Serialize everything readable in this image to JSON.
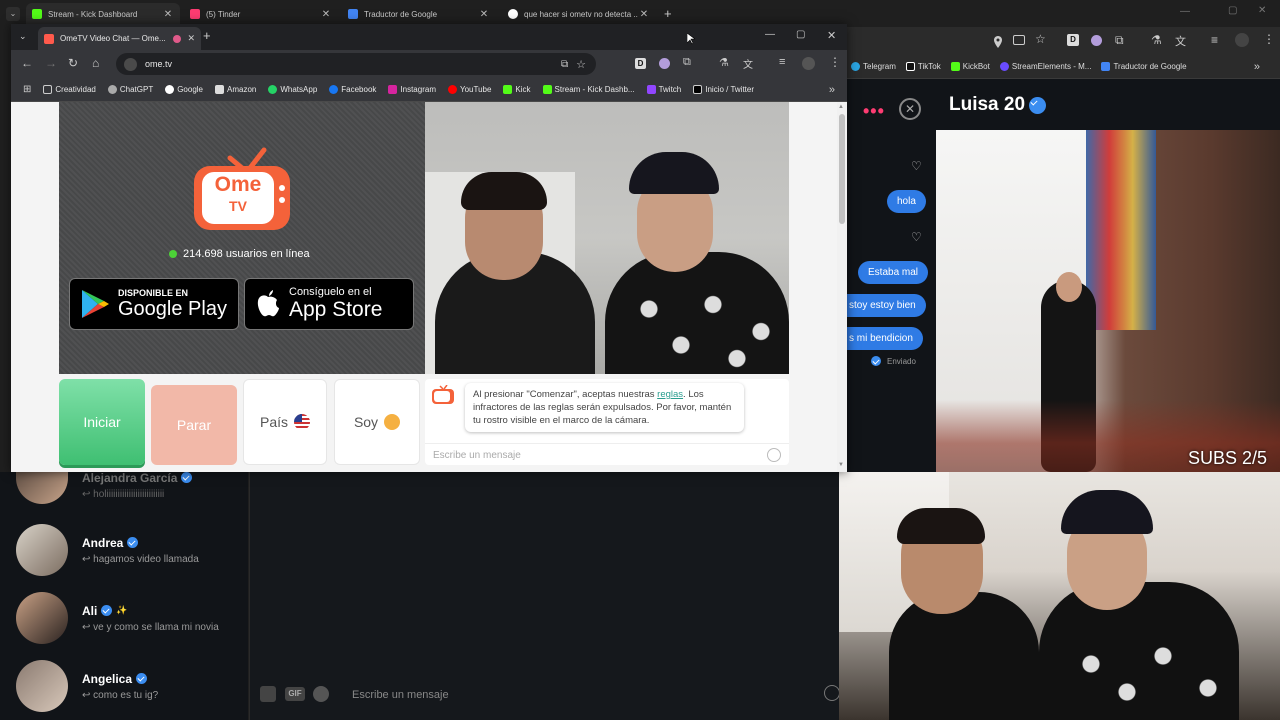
{
  "bg_browser": {
    "tabs": [
      {
        "label": "Stream - Kick Dashboard",
        "color": "#53fc18"
      },
      {
        "label": "(5) Tinder",
        "color": "#fe3c72"
      },
      {
        "label": "Traductor de Google",
        "color": "#4285f4"
      },
      {
        "label": "que hacer si ometv no detecta ...",
        "color": "#ffffff"
      }
    ],
    "bookmarks": [
      "Telegram",
      "TikTok",
      "KickBot",
      "StreamElements - M...",
      "Traductor de Google"
    ]
  },
  "tinder": {
    "profile_name": "Luisa 20",
    "messages": [
      "hola",
      "Estaba mal",
      "stoy estoy bien",
      "s mi bendicion"
    ],
    "sent_status": "Enviado",
    "subs_overlay": "SUBS 2/5",
    "matches": [
      {
        "name": "Alejandra García",
        "msg": "holiiiiiiiiiiiiiiiiiiiiiiiiii"
      },
      {
        "name": "Andrea",
        "msg": "hagamos video llamada"
      },
      {
        "name": "Ali",
        "msg": "ve y como se llama mi novia"
      },
      {
        "name": "Angelica",
        "msg": "como es tu ig?"
      }
    ],
    "composer_placeholder": "Escribe un mensaje",
    "gif_label": "GIF"
  },
  "front": {
    "tab_title": "OmeTV Video Chat — Ome...",
    "url": "ome.tv",
    "bookmarks": [
      "Creatividad",
      "ChatGPT",
      "Google",
      "Amazon",
      "WhatsApp",
      "Facebook",
      "Instagram",
      "YouTube",
      "Kick",
      "Stream - Kick Dashb...",
      "Twitch",
      "Inicio / Twitter"
    ],
    "logo_line1": "Ome",
    "logo_line2": "TV",
    "online_count": "214.698 usuarios en línea",
    "google_play_small": "DISPONIBLE EN",
    "google_play_big": "Google Play",
    "app_store_small": "Consíguelo en el",
    "app_store_big": "App Store",
    "start_label": "Iniciar",
    "stop_label": "Parar",
    "country_label": "País",
    "gender_label": "Soy",
    "notice_pre": "Al presionar \"Comenzar\", aceptas nuestras ",
    "notice_link": "reglas",
    "notice_post": ". Los infractores de las reglas serán expulsados. Por favor, mantén tu rostro visible en el marco de la cámara.",
    "message_placeholder": "Escribe un mensaje"
  }
}
